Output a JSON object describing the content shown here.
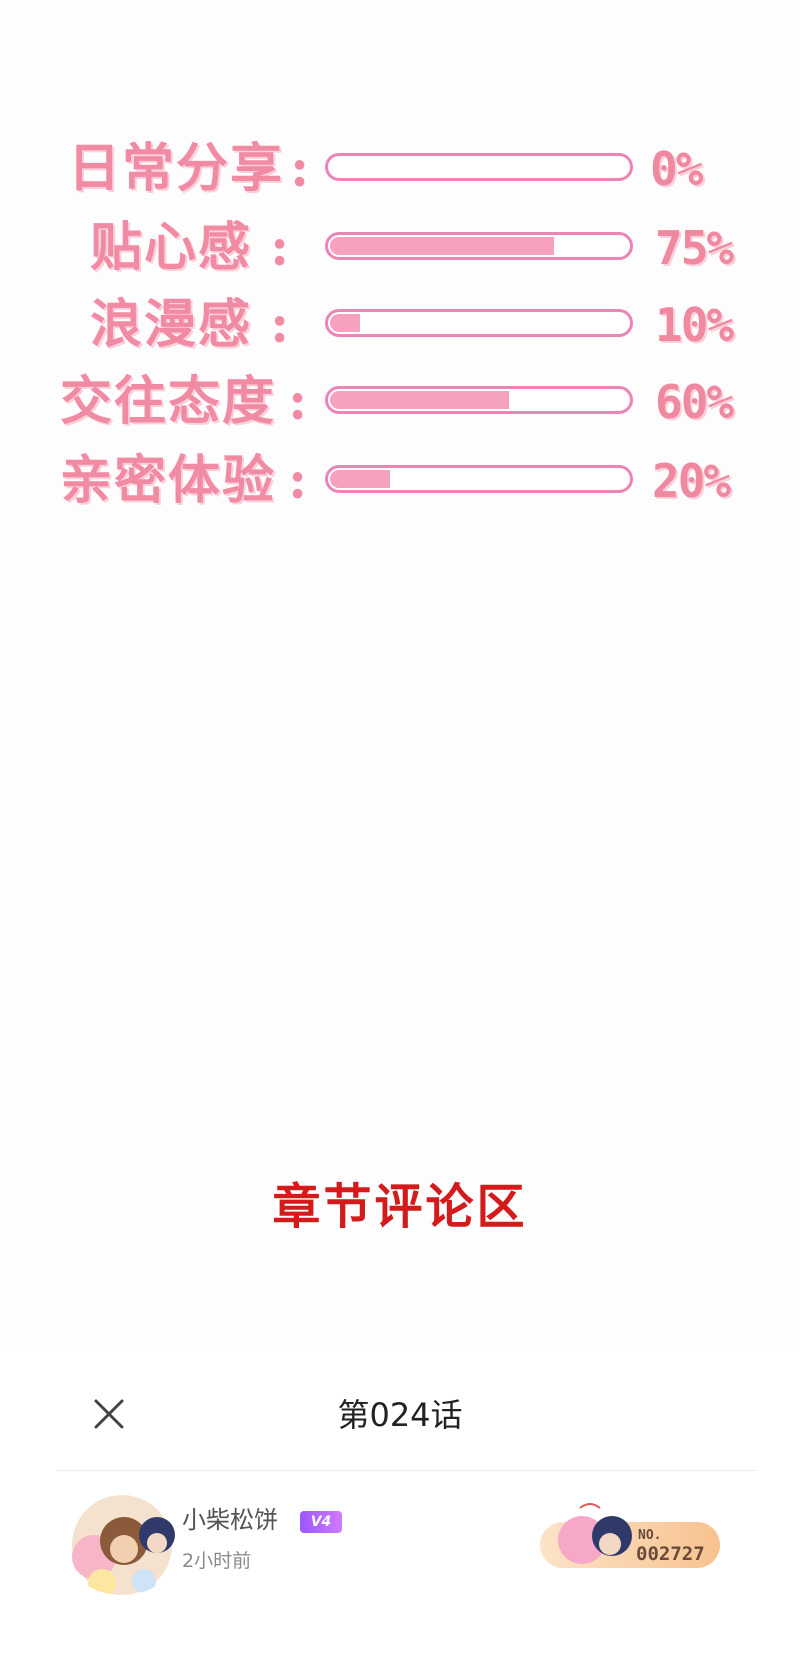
{
  "stats": [
    {
      "label": "日常分享",
      "percent_text": "0%",
      "value": 0
    },
    {
      "label": "贴心感",
      "percent_text": "75%",
      "value": 0.75
    },
    {
      "label": "浪漫感",
      "percent_text": "10%",
      "value": 0.1
    },
    {
      "label": "交往态度",
      "percent_text": "60%",
      "value": 0.6
    },
    {
      "label": "亲密体验",
      "percent_text": "20%",
      "value": 0.2
    }
  ],
  "colon": ":",
  "section_title": "章节评论区",
  "comment_panel": {
    "title": "第024话",
    "close_icon": "close-icon"
  },
  "comment": {
    "username": "小柴松饼",
    "level": "V4",
    "timestamp": "2小时前",
    "fan_card_label": "NO.",
    "fan_card_number": "002727"
  },
  "colors": {
    "stat_text": "#f18aa3",
    "bar_border": "#ec85b6",
    "bar_fill": "#f6a2bf",
    "section_title": "#d41b1b",
    "level_badge": "#b066ff"
  }
}
